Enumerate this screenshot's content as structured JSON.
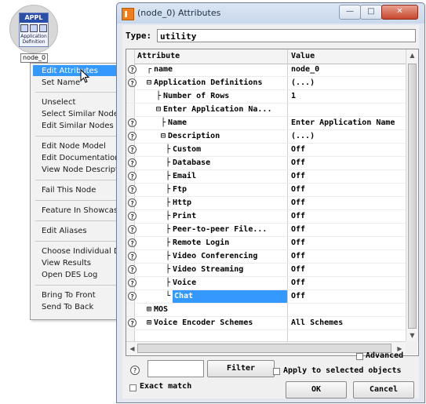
{
  "node": {
    "header": "APPL",
    "subtitle_line1": "Application",
    "subtitle_line2": "Definition",
    "label": "node_0"
  },
  "context_menu": {
    "items": [
      {
        "label": "Edit Attributes",
        "highlighted": true
      },
      {
        "label": "Set Name"
      },
      {
        "label": "Unselect"
      },
      {
        "label": "Select Similar Nodes"
      },
      {
        "label": "Edit Similar Nodes"
      },
      {
        "label": "Edit Node Model"
      },
      {
        "label": "Edit Documentation"
      },
      {
        "label": "View Node Descripti"
      },
      {
        "label": "Fail This Node"
      },
      {
        "label": "Feature In Showcase"
      },
      {
        "label": "Edit Aliases"
      },
      {
        "label": "Choose Individual DE"
      },
      {
        "label": "View Results"
      },
      {
        "label": "Open DES Log"
      },
      {
        "label": "Bring To Front"
      },
      {
        "label": "Send To Back"
      }
    ]
  },
  "window": {
    "title": "(node_0) Attributes",
    "type_label": "Type:",
    "type_value": "utility",
    "columns": {
      "attribute": "Attribute",
      "value": "Value"
    },
    "rows": [
      {
        "help": true,
        "attribute": "name",
        "value": "node_0",
        "prefix": "┌"
      },
      {
        "help": true,
        "attribute": "Application Definitions",
        "value": "(...)",
        "prefix": "⊟"
      },
      {
        "help": false,
        "attribute": "Number of Rows",
        "value": "1",
        "prefix": "├"
      },
      {
        "help": false,
        "attribute": "Enter Application Na...",
        "value": "",
        "prefix": "⊟"
      },
      {
        "help": true,
        "attribute": "Name",
        "value": "Enter Application Name",
        "prefix": "├"
      },
      {
        "help": true,
        "attribute": "Description",
        "value": "(...)",
        "prefix": "⊟"
      },
      {
        "help": true,
        "attribute": "Custom",
        "value": "Off",
        "prefix": "├"
      },
      {
        "help": true,
        "attribute": "Database",
        "value": "Off",
        "prefix": "├"
      },
      {
        "help": true,
        "attribute": "Email",
        "value": "Off",
        "prefix": "├"
      },
      {
        "help": true,
        "attribute": "Ftp",
        "value": "Off",
        "prefix": "├"
      },
      {
        "help": true,
        "attribute": "Http",
        "value": "Off",
        "prefix": "├"
      },
      {
        "help": true,
        "attribute": "Print",
        "value": "Off",
        "prefix": "├"
      },
      {
        "help": true,
        "attribute": "Peer-to-peer File...",
        "value": "Off",
        "prefix": "├"
      },
      {
        "help": true,
        "attribute": "Remote Login",
        "value": "Off",
        "prefix": "├"
      },
      {
        "help": true,
        "attribute": "Video Conferencing",
        "value": "Off",
        "prefix": "├"
      },
      {
        "help": true,
        "attribute": "Video Streaming",
        "value": "Off",
        "prefix": "├"
      },
      {
        "help": true,
        "attribute": "Voice",
        "value": "Off",
        "prefix": "├"
      },
      {
        "help": true,
        "attribute": "Chat",
        "value": "Off",
        "prefix": "└",
        "selected": true
      },
      {
        "help": false,
        "attribute": "MOS",
        "value": "",
        "prefix": "⊞"
      },
      {
        "help": true,
        "attribute": "Voice Encoder Schemes",
        "value": "All Schemes",
        "prefix": "⊞"
      }
    ],
    "filter_button": "Filter",
    "exact_match_label": "Exact match",
    "advanced_label": "Advanced",
    "apply_label": "Apply to selected objects",
    "ok_button": "OK",
    "cancel_button": "Cancel"
  },
  "colors": {
    "selection": "#3399ff",
    "title_bar": "#c9d8ec",
    "close_button": "#c8472d",
    "node_header": "#2b4fa8"
  }
}
